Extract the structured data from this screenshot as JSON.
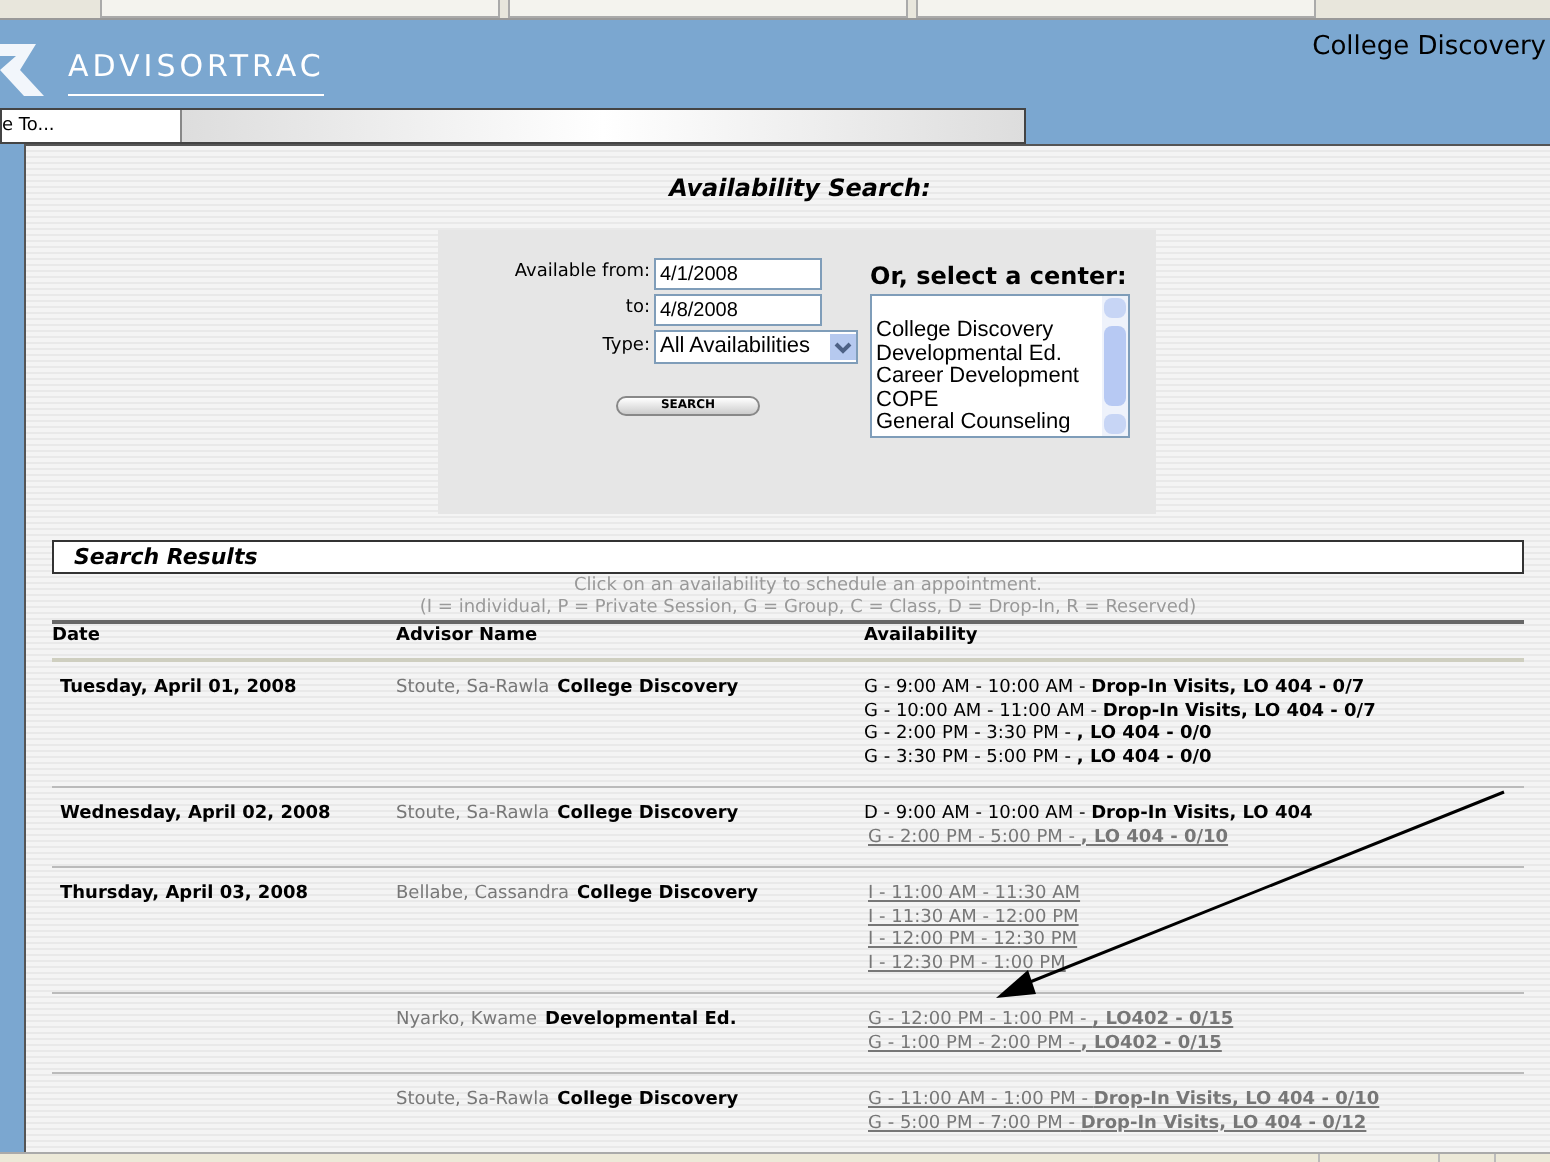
{
  "header": {
    "logo": "ADVISORTRAC",
    "center": "College Discovery",
    "goto": "e To..."
  },
  "search": {
    "title": "Availability Search:",
    "from_label": "Available from:",
    "from": "4/1/2008",
    "to_label": "to:",
    "to": "4/8/2008",
    "type_label": "Type:",
    "type": "All Availabilities",
    "button": "SEARCH",
    "center_heading": "Or, select a center:",
    "centers": [
      {
        "label": "College Discovery",
        "selected": false
      },
      {
        "label": "Developmental Ed.",
        "selected": false
      },
      {
        "label": "Career Development",
        "selected": false
      },
      {
        "label": "COPE",
        "selected": false
      },
      {
        "label": "General Counseling",
        "selected": false
      }
    ]
  },
  "results": {
    "title": "Search Results",
    "hint": "Click on an availability to schedule an appointment.",
    "legend": "(I = individual, P = Private Session, G = Group, C = Class, D = Drop-In, R = Reserved)",
    "columns": [
      "Date",
      "Advisor Name",
      "Availability"
    ],
    "rows": [
      {
        "date": "Tuesday, April 01, 2008",
        "advisor": "Stoute, Sa-Rawla",
        "center": "College Discovery",
        "slots": [
          {
            "kind": "plain",
            "text": "G - 9:00 AM - 10:00 AM - **Drop-In Visits, LO 404 - 0/7**"
          },
          {
            "kind": "plain",
            "text": "G - 10:00 AM - 11:00 AM - **Drop-In Visits, LO 404 - 0/7**"
          },
          {
            "kind": "plain",
            "text": "G - 2:00 PM - 3:30 PM - **, LO 404 - 0/0**"
          },
          {
            "kind": "plain",
            "text": "G - 3:30 PM - 5:00 PM - **, LO 404 - 0/0**"
          }
        ]
      },
      {
        "date": "Wednesday, April 02, 2008",
        "advisor": "Stoute, Sa-Rawla",
        "center": "College Discovery",
        "slots": [
          {
            "kind": "plain",
            "text": "D - 9:00 AM - 10:00 AM - **Drop-In Visits, LO 404**"
          },
          {
            "kind": "link",
            "text": "G - 2:00 PM - 5:00 PM - **, LO 404 - 0/10**"
          }
        ]
      },
      {
        "date": "Thursday, April 03, 2008",
        "advisor": "Bellabe, Cassandra",
        "center": "College Discovery",
        "slots": [
          {
            "kind": "link",
            "text": "I - 11:00 AM - 11:30 AM"
          },
          {
            "kind": "link",
            "text": "I - 11:30 AM - 12:00 PM"
          },
          {
            "kind": "link",
            "text": "I - 12:00 PM - 12:30 PM"
          },
          {
            "kind": "link",
            "text": "I - 12:30 PM - 1:00 PM"
          }
        ]
      },
      {
        "advisor": "Nyarko, Kwame",
        "center": "Developmental Ed.",
        "slots": [
          {
            "kind": "link",
            "text": "G - 12:00 PM - 1:00 PM - **, LO402 - 0/15**"
          },
          {
            "kind": "link",
            "text": "G - 1:00 PM - 2:00 PM - **, LO402 - 0/15**"
          }
        ]
      },
      {
        "advisor": "Stoute, Sa-Rawla",
        "center": "College Discovery",
        "slots": [
          {
            "kind": "link",
            "text": "G - 11:00 AM - 1:00 PM - **Drop-In Visits, LO 404 - 0/10**"
          },
          {
            "kind": "link",
            "text": "G - 5:00 PM - 7:00 PM - **Drop-In Visits, LO 404 - 0/12**"
          }
        ]
      }
    ]
  }
}
